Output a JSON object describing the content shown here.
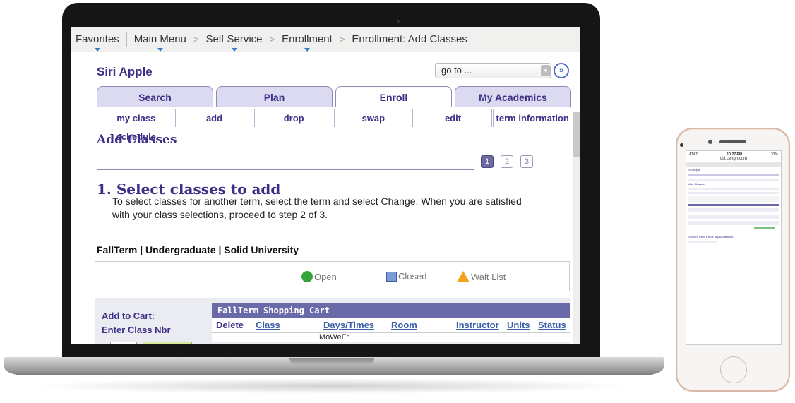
{
  "breadcrumb": {
    "items": [
      "Favorites",
      "Main Menu",
      "Self Service",
      "Enrollment",
      "Enrollment: Add Classes"
    ],
    "separator": ">"
  },
  "user": {
    "name": "Siri Apple"
  },
  "goto": {
    "value": "go to ...",
    "button_icon": "double-chevron-right-icon"
  },
  "tabs": [
    {
      "label": "Search",
      "active": false
    },
    {
      "label": "Plan",
      "active": false
    },
    {
      "label": "Enroll",
      "active": true
    },
    {
      "label": "My Academics",
      "active": false
    }
  ],
  "subtabs": [
    {
      "label": "my class schedule",
      "active": false
    },
    {
      "label": "add",
      "active": true
    },
    {
      "label": "drop",
      "active": false
    },
    {
      "label": "swap",
      "active": false
    },
    {
      "label": "edit",
      "active": false
    },
    {
      "label": "term information",
      "active": false
    }
  ],
  "page": {
    "title": "Add Classes",
    "steps": [
      "1",
      "2",
      "3"
    ],
    "current_step": 1,
    "section_title": "1.  Select classes to add",
    "instructions": "To select classes for another term, select the term and select Change.  When you are satisfied with your class selections, proceed to step 2 of 3.",
    "term_line": "FallTerm | Undergraduate | Solid University"
  },
  "legend": {
    "open": "Open",
    "closed": "Closed",
    "wait_list": "Wait List",
    "colors": {
      "open": "#36a43a",
      "closed": "#7b9bd6",
      "wait_list": "#f3a31b"
    }
  },
  "cart": {
    "add_to_cart_label": "Add to Cart:",
    "enter_class_nbr_label": "Enter Class Nbr",
    "title": "FallTerm Shopping Cart",
    "columns": [
      "Delete",
      "Class",
      "Days/Times",
      "Room",
      "Instructor",
      "Units",
      "Status"
    ],
    "partial_row_text": "MoWeFr"
  },
  "phone": {
    "carrier": "AT&T",
    "time": "10:27 PM",
    "battery": "33%",
    "url": "csl.cengh.com"
  },
  "colors": {
    "accent": "#3b2f86",
    "header_bar": "#6b6aa8",
    "tab_bg": "#dcdaf0"
  }
}
